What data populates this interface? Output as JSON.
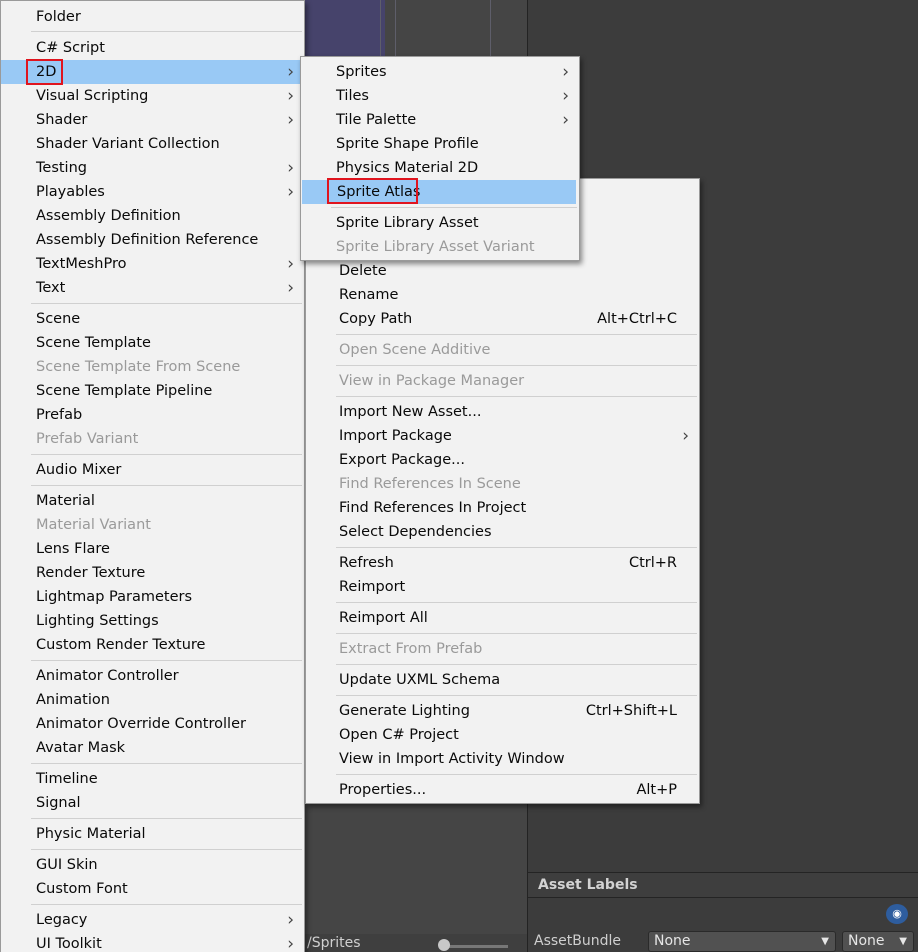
{
  "create_menu": {
    "items": [
      {
        "label": "Folder"
      },
      {
        "label": "C# Script"
      },
      {
        "label": "2D",
        "submenu": true,
        "highlighted": true
      },
      {
        "label": "Visual Scripting",
        "submenu": true
      },
      {
        "label": "Shader",
        "submenu": true
      },
      {
        "label": "Shader Variant Collection"
      },
      {
        "label": "Testing",
        "submenu": true
      },
      {
        "label": "Playables",
        "submenu": true
      },
      {
        "label": "Assembly Definition"
      },
      {
        "label": "Assembly Definition Reference"
      },
      {
        "label": "TextMeshPro",
        "submenu": true
      },
      {
        "label": "Text",
        "submenu": true
      },
      {
        "label": "Scene"
      },
      {
        "label": "Scene Template"
      },
      {
        "label": "Scene Template From Scene",
        "disabled": true
      },
      {
        "label": "Scene Template Pipeline"
      },
      {
        "label": "Prefab"
      },
      {
        "label": "Prefab Variant",
        "disabled": true
      },
      {
        "label": "Audio Mixer"
      },
      {
        "label": "Material"
      },
      {
        "label": "Material Variant",
        "disabled": true
      },
      {
        "label": "Lens Flare"
      },
      {
        "label": "Render Texture"
      },
      {
        "label": "Lightmap Parameters"
      },
      {
        "label": "Lighting Settings"
      },
      {
        "label": "Custom Render Texture"
      },
      {
        "label": "Animator Controller"
      },
      {
        "label": "Animation"
      },
      {
        "label": "Animator Override Controller"
      },
      {
        "label": "Avatar Mask"
      },
      {
        "label": "Timeline"
      },
      {
        "label": "Signal"
      },
      {
        "label": "Physic Material"
      },
      {
        "label": "GUI Skin"
      },
      {
        "label": "Custom Font"
      },
      {
        "label": "Legacy",
        "submenu": true
      },
      {
        "label": "UI Toolkit",
        "submenu": true
      }
    ]
  },
  "context_menu": {
    "items": [
      {
        "label": ""
      },
      {
        "label": ""
      },
      {
        "label": "Delete"
      },
      {
        "label": "Rename"
      },
      {
        "label": "Copy Path",
        "shortcut": "Alt+Ctrl+C"
      },
      {
        "label": "Open Scene Additive",
        "disabled": true
      },
      {
        "label": "View in Package Manager",
        "disabled": true
      },
      {
        "label": "Import New Asset..."
      },
      {
        "label": "Import Package",
        "submenu": true
      },
      {
        "label": "Export Package..."
      },
      {
        "label": "Find References In Scene",
        "disabled": true
      },
      {
        "label": "Find References In Project"
      },
      {
        "label": "Select Dependencies"
      },
      {
        "label": "Refresh",
        "shortcut": "Ctrl+R"
      },
      {
        "label": "Reimport"
      },
      {
        "label": "Reimport All"
      },
      {
        "label": "Extract From Prefab",
        "disabled": true
      },
      {
        "label": "Update UXML Schema"
      },
      {
        "label": "Generate Lighting",
        "shortcut": "Ctrl+Shift+L"
      },
      {
        "label": "Open C# Project"
      },
      {
        "label": "View in Import Activity Window"
      },
      {
        "label": "Properties...",
        "shortcut": "Alt+P"
      }
    ]
  },
  "submenu_2d": {
    "items": [
      {
        "label": "Sprites",
        "submenu": true
      },
      {
        "label": "Tiles",
        "submenu": true
      },
      {
        "label": "Tile Palette",
        "submenu": true
      },
      {
        "label": "Sprite Shape Profile"
      },
      {
        "label": "Physics Material 2D"
      },
      {
        "label": "Sprite Atlas",
        "highlighted": true
      },
      {
        "label": "Sprite Library Asset"
      },
      {
        "label": "Sprite Library Asset Variant",
        "disabled": true
      }
    ]
  },
  "inspector": {
    "asset_labels_title": "Asset Labels",
    "assetbundle_label": "AssetBundle",
    "assetbundle_value": "None",
    "variant_value": "None"
  },
  "project_path": "/Sprites",
  "icons": {
    "submenu_arrow": "chevron-right-icon",
    "tag": "tag-icon",
    "dropdown_arrow": "triangle-down-icon"
  },
  "colors": {
    "menu_background": "#f2f2f2",
    "highlight": "#99c9f5",
    "annotation_box": "#e0141e",
    "disabled_text": "#9a9a9a"
  }
}
